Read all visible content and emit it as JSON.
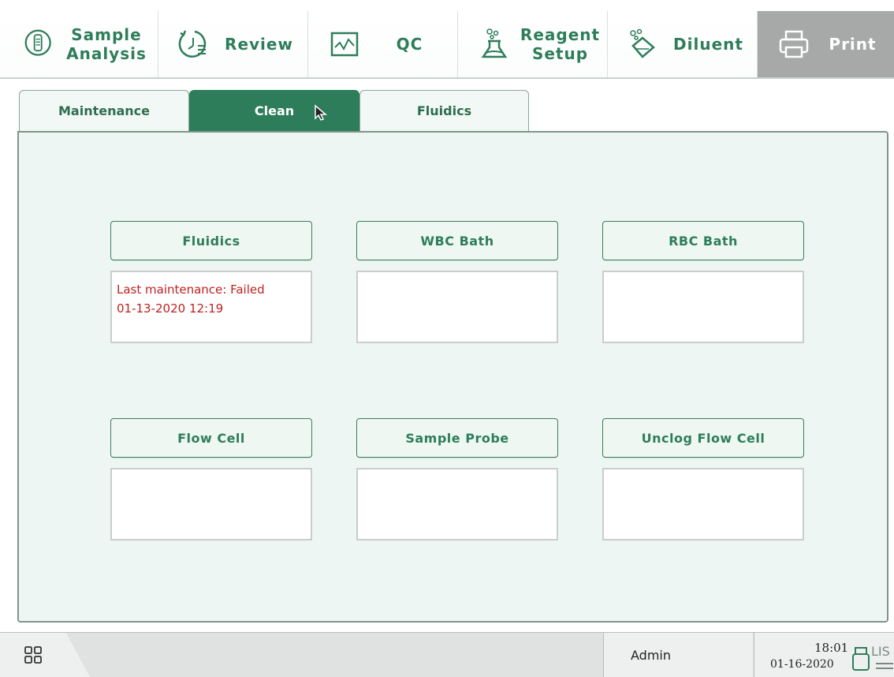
{
  "toolbar": {
    "items": [
      {
        "line1": "Sample",
        "line2": "Analysis",
        "icon": "sample-tube-icon"
      },
      {
        "line1": "Review",
        "line2": "",
        "icon": "review-history-icon"
      },
      {
        "line1": "QC",
        "line2": "",
        "icon": "qc-chart-icon"
      },
      {
        "line1": "Reagent",
        "line2": "Setup",
        "icon": "reagent-flask-icon"
      },
      {
        "line1": "Diluent",
        "line2": "",
        "icon": "diluent-icon"
      },
      {
        "line1": "Print",
        "line2": "",
        "icon": "printer-icon"
      }
    ]
  },
  "tabs": [
    {
      "label": "Maintenance",
      "active": false
    },
    {
      "label": "Clean",
      "active": true
    },
    {
      "label": "Fluidics",
      "active": false
    }
  ],
  "clean_items": [
    {
      "label": "Fluidics",
      "status_line1": "Last maintenance: Failed",
      "status_line2": "01-13-2020 12:19"
    },
    {
      "label": "WBC Bath",
      "status_line1": "",
      "status_line2": ""
    },
    {
      "label": "RBC Bath",
      "status_line1": "",
      "status_line2": ""
    },
    {
      "label": "Flow Cell",
      "status_line1": "",
      "status_line2": ""
    },
    {
      "label": "Sample Probe",
      "status_line1": "",
      "status_line2": ""
    },
    {
      "label": "Unclog Flow Cell",
      "status_line1": "",
      "status_line2": ""
    }
  ],
  "statusbar": {
    "user": "Admin",
    "time": "18:01",
    "date": "01-16-2020",
    "lis_label": "LIS"
  },
  "colors": {
    "accent": "#2e7d5a",
    "panel_bg": "#eef6f4",
    "error_text": "#c02020",
    "active_toolbar": "#a7a9a8"
  }
}
